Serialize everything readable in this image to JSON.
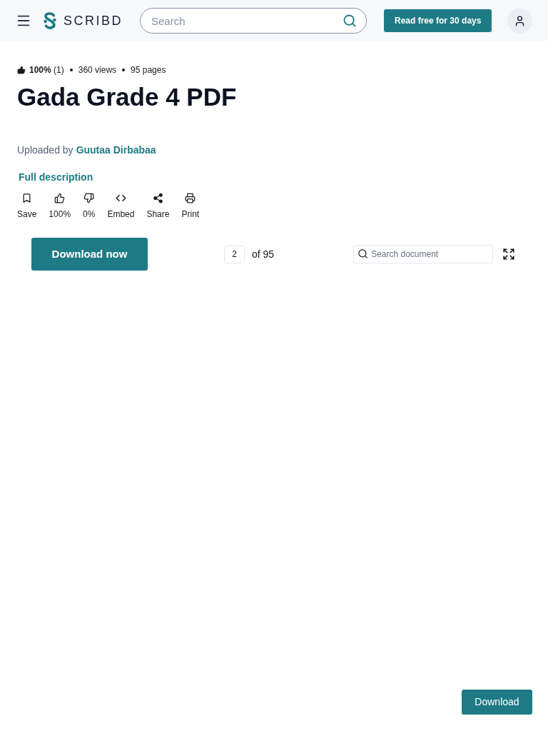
{
  "header": {
    "logo_text": "SCRIBD",
    "search": {
      "placeholder": "Search"
    },
    "cta": "Read free for 30 days"
  },
  "stats": {
    "rating": "**100%** (1)",
    "views": "360 views",
    "pages": "95 pages"
  },
  "title": "Gada Grade 4 PDF",
  "uploader": {
    "prefix": "Uploaded by",
    "name": "Guutaa Dirbabaa"
  },
  "description_link": "Full description",
  "actions": [
    {
      "kind": "save",
      "label": "Save"
    },
    {
      "kind": "like",
      "label": "100%"
    },
    {
      "kind": "dislike",
      "label": "0%"
    },
    {
      "kind": "embed",
      "label": "Embed"
    },
    {
      "kind": "share",
      "label": "Share"
    },
    {
      "kind": "print",
      "label": "Print"
    }
  ],
  "toolbar": {
    "download": "Download now",
    "page": "2",
    "page_total": "of 95",
    "search": {
      "placeholder": "Search document"
    }
  },
  "footer_button": "Download"
}
